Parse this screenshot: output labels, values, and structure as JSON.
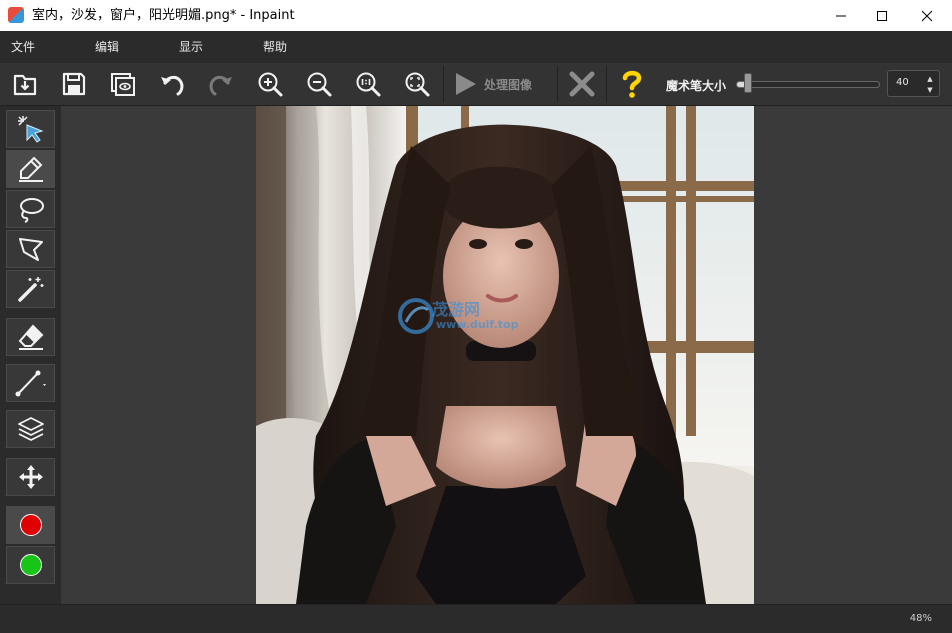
{
  "window": {
    "title": "室内，沙发，窗户，阳光明媚.png* - Inpaint"
  },
  "menu": [
    "文件",
    "编辑",
    "显示",
    "帮助"
  ],
  "toolbar": {
    "process_label": "处理图像",
    "brush_size_label": "魔术笔大小",
    "brush_size_value": "40",
    "brush_size_fraction": 0.08
  },
  "watermark": {
    "line1": "茂游网",
    "line2": "www.duif.top"
  },
  "status": {
    "zoom": "48%"
  },
  "colors": {
    "accent_red": "#e00000",
    "accent_green": "#19c419",
    "help_yellow": "#ffd400"
  },
  "icons": [
    "open-icon",
    "save-icon",
    "preview-icon",
    "undo-icon",
    "redo-icon",
    "zoom-in-icon",
    "zoom-out-icon",
    "zoom-actual-icon",
    "zoom-fit-icon",
    "play-icon",
    "close-x-icon",
    "help-icon"
  ]
}
